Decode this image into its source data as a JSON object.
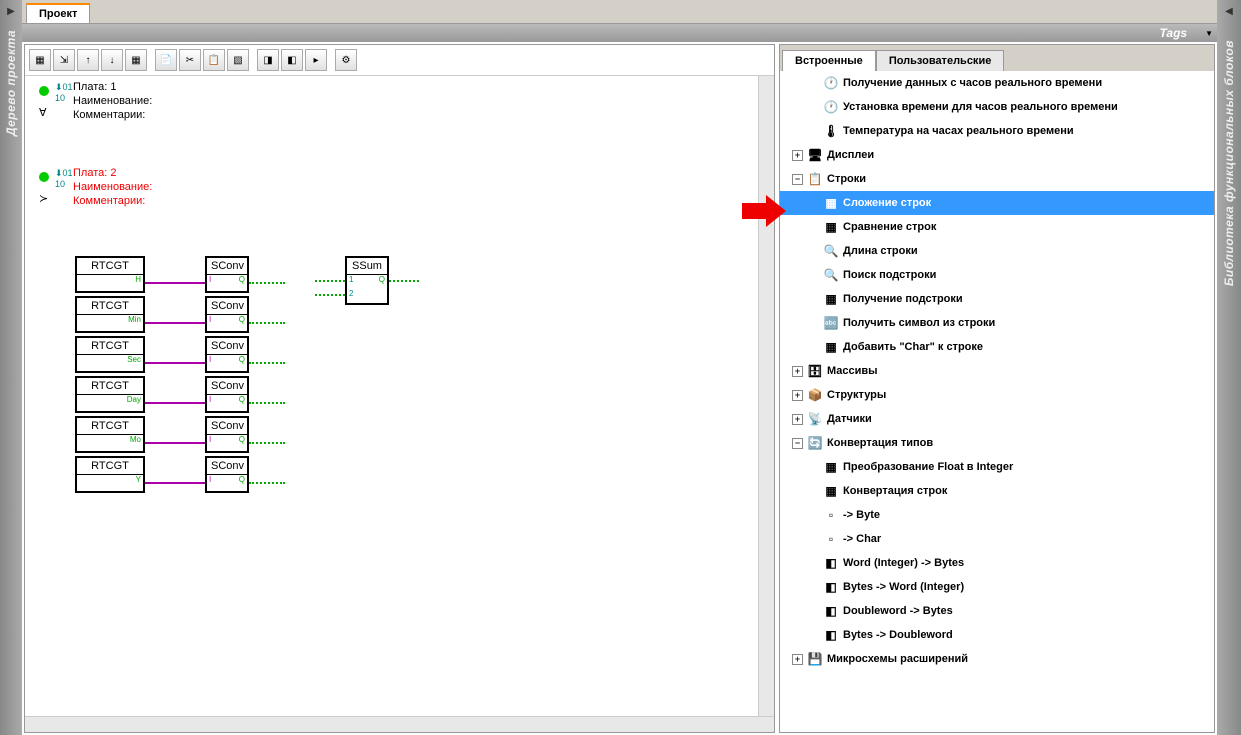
{
  "left_sidebar": {
    "label": "Дерево проекта"
  },
  "right_sidebar": {
    "label": "Библиотека функциональных блоков"
  },
  "top_tab": "Проект",
  "tags_label": "Tags",
  "boards": {
    "b1": {
      "plata": "Плата: 1",
      "name_label": "Наименование:",
      "comment_label": "Комментарии:"
    },
    "b2": {
      "plata": "Плата: 2",
      "name_label": "Наименование:",
      "comment_label": "Комментарии:"
    }
  },
  "fbd": {
    "rtcgt": "RTCGT",
    "sconv": "SConv",
    "ssum": "SSum",
    "ports": {
      "h": "H",
      "min": "Min",
      "sec": "Sec",
      "day": "Day",
      "mo": "Mo",
      "y": "Y",
      "i": "I",
      "q": "Q",
      "p1": "1",
      "p2": "2"
    }
  },
  "right_tabs": {
    "builtin": "Встроенные",
    "user": "Пользовательские"
  },
  "tree": [
    {
      "depth": 2,
      "icon": "🕐",
      "label": "Получение данных с часов реального времени"
    },
    {
      "depth": 2,
      "icon": "🕐",
      "label": "Установка времени для часов реального времени"
    },
    {
      "depth": 2,
      "icon": "🌡",
      "label": "Температура на часах реального времени"
    },
    {
      "depth": 1,
      "expand": "+",
      "icon": "🖥",
      "label": "Дисплеи"
    },
    {
      "depth": 1,
      "expand": "−",
      "icon": "📋",
      "label": "Строки"
    },
    {
      "depth": 2,
      "icon": "▦",
      "label": "Сложение строк",
      "selected": true
    },
    {
      "depth": 2,
      "icon": "▦",
      "label": "Сравнение строк"
    },
    {
      "depth": 2,
      "icon": "🔍",
      "label": "Длина строки"
    },
    {
      "depth": 2,
      "icon": "🔍",
      "label": "Поиск подстроки"
    },
    {
      "depth": 2,
      "icon": "▦",
      "label": "Получение подстроки"
    },
    {
      "depth": 2,
      "icon": "🔤",
      "label": "Получить символ из строки"
    },
    {
      "depth": 2,
      "icon": "▦",
      "label": "Добавить \"Char\" к строке"
    },
    {
      "depth": 1,
      "expand": "+",
      "icon": "🗄",
      "label": "Массивы"
    },
    {
      "depth": 1,
      "expand": "+",
      "icon": "📦",
      "label": "Структуры"
    },
    {
      "depth": 1,
      "expand": "+",
      "icon": "📡",
      "label": "Датчики"
    },
    {
      "depth": 1,
      "expand": "−",
      "icon": "🔄",
      "label": "Конвертация типов"
    },
    {
      "depth": 2,
      "icon": "▦",
      "label": "Преобразование Float в Integer"
    },
    {
      "depth": 2,
      "icon": "▦",
      "label": "Конвертация строк"
    },
    {
      "depth": 2,
      "icon": "▫",
      "label": "-> Byte"
    },
    {
      "depth": 2,
      "icon": "▫",
      "label": "-> Char"
    },
    {
      "depth": 2,
      "icon": "◧",
      "label": "Word (Integer) -> Bytes"
    },
    {
      "depth": 2,
      "icon": "◧",
      "label": "Bytes -> Word (Integer)"
    },
    {
      "depth": 2,
      "icon": "◧",
      "label": "Doubleword -> Bytes"
    },
    {
      "depth": 2,
      "icon": "◧",
      "label": "Bytes -> Doubleword"
    },
    {
      "depth": 1,
      "expand": "+",
      "icon": "💾",
      "label": "Микросхемы расширений"
    }
  ]
}
